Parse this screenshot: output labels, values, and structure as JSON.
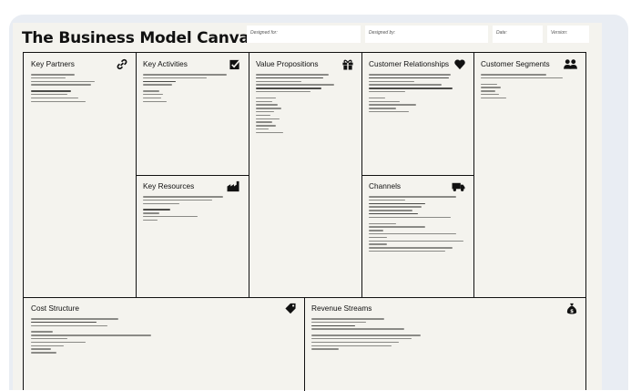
{
  "canvas": {
    "title": "The Business Model Canvas",
    "fields": {
      "designed_for": "Designed for:",
      "designed_by": "Designed by:",
      "date": "Date:",
      "version": "Version:"
    }
  },
  "blocks": {
    "key_partners": {
      "label": "Key Partners",
      "icon": "link-icon"
    },
    "key_activities": {
      "label": "Key Activities",
      "icon": "checkbox-icon"
    },
    "key_resources": {
      "label": "Key Resources",
      "icon": "factory-icon"
    },
    "value_propositions": {
      "label": "Value Propositions",
      "icon": "gift-icon"
    },
    "customer_relationships": {
      "label": "Customer Relationships",
      "icon": "heart-icon"
    },
    "channels": {
      "label": "Channels",
      "icon": "truck-icon"
    },
    "customer_segments": {
      "label": "Customer Segments",
      "icon": "people-icon"
    },
    "cost_structure": {
      "label": "Cost Structure",
      "icon": "tag-icon"
    },
    "revenue_streams": {
      "label": "Revenue Streams",
      "icon": "money-bag-icon"
    }
  },
  "colors": {
    "ink": "#111111",
    "paper": "#f4f3ee",
    "frame": "#e9edf3"
  }
}
